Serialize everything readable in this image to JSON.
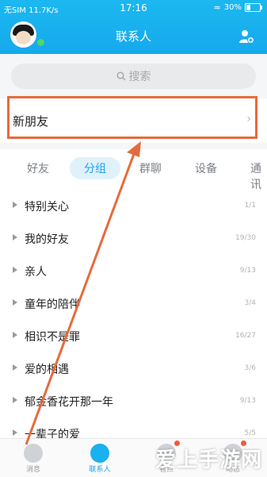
{
  "status_bar": {
    "carrier": "无SIM 11.7K/s",
    "time": "17:16",
    "battery": "30%",
    "battery_level": 0.3
  },
  "header": {
    "title": "联系人"
  },
  "search": {
    "placeholder": "搜索"
  },
  "new_friends": {
    "label": "新朋友"
  },
  "tabs": [
    {
      "label": "好友"
    },
    {
      "label": "分组",
      "active": true
    },
    {
      "label": "群聊"
    },
    {
      "label": "设备"
    },
    {
      "label": "通讯"
    }
  ],
  "groups": [
    {
      "label": "特别关心",
      "count": "1/1"
    },
    {
      "label": "我的好友",
      "count": "19/30"
    },
    {
      "label": "亲人",
      "count": "9/13"
    },
    {
      "label": "童年的陪伴",
      "count": "3/4"
    },
    {
      "label": "相识不是罪",
      "count": "16/27"
    },
    {
      "label": "爱的相遇",
      "count": "3/6"
    },
    {
      "label": "郁金香花开那一年",
      "count": "9/13"
    },
    {
      "label": "一辈子的爱",
      "count": "5/5"
    }
  ],
  "bottom_nav": [
    {
      "label": "消息"
    },
    {
      "label": "联系人",
      "active": true
    },
    {
      "label": "看点"
    },
    {
      "label": "动态"
    }
  ],
  "watermark": "爱上手游网",
  "colors": {
    "accent": "#16a9ec",
    "highlight": "#e66b3c",
    "badge": "#f3593a"
  }
}
